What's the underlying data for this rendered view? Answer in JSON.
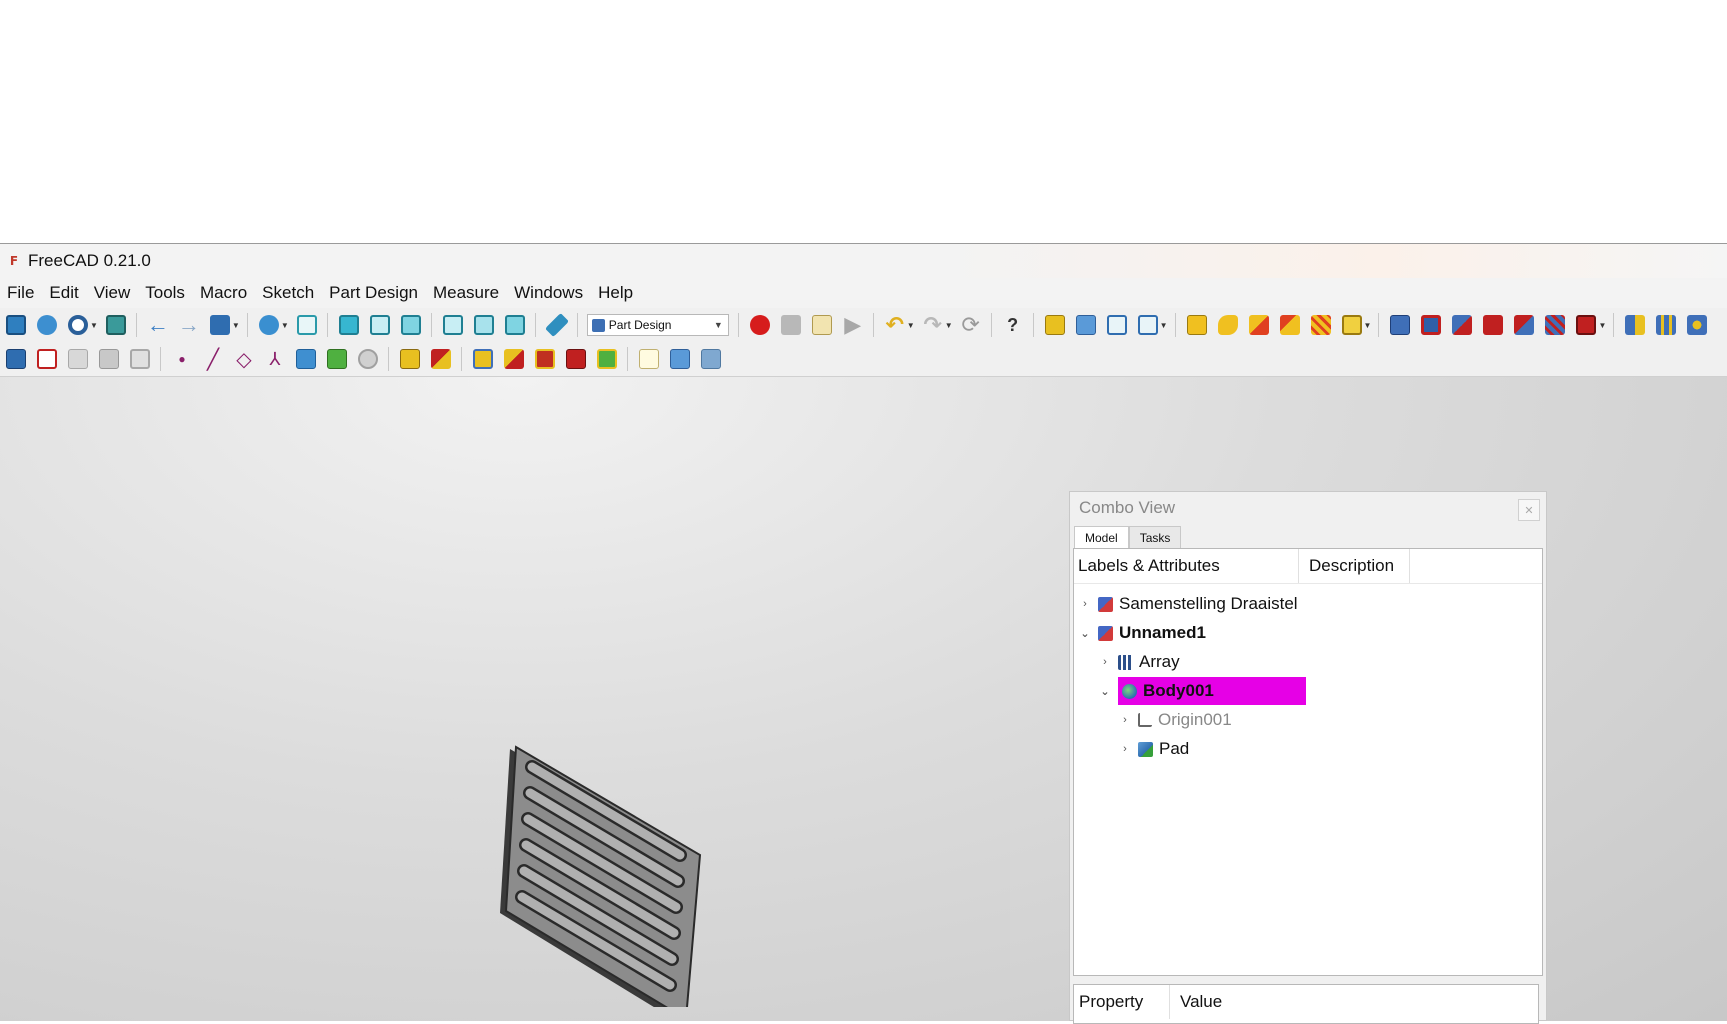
{
  "window": {
    "title": "FreeCAD 0.21.0",
    "app_icon": "freecad-logo"
  },
  "menu": [
    "File",
    "Edit",
    "View",
    "Tools",
    "Macro",
    "Sketch",
    "Part Design",
    "Measure",
    "Windows",
    "Help"
  ],
  "toolbar": {
    "workbench_selected": "Part Design"
  },
  "colors": {
    "selection": "#e600e6",
    "macro_record": "#d61c1c",
    "accent_blue": "#2f6db0"
  },
  "combo_view": {
    "title": "Combo View",
    "tabs": [
      "Model",
      "Tasks"
    ],
    "active_tab": "Model",
    "columns": [
      "Labels & Attributes",
      "Description"
    ],
    "tree": [
      {
        "label": "Samenstelling Draaistel",
        "expanded": false,
        "bold": false
      },
      {
        "label": "Unnamed1",
        "expanded": true,
        "bold": true
      },
      {
        "label": "Array",
        "expanded": false,
        "bold": false
      },
      {
        "label": "Body001",
        "expanded": true,
        "bold": true,
        "selected": true
      },
      {
        "label": "Origin001",
        "expanded": false,
        "dimmed": true
      },
      {
        "label": "Pad",
        "expanded": false,
        "bold": false
      }
    ],
    "property_columns": [
      "Property",
      "Value"
    ]
  }
}
